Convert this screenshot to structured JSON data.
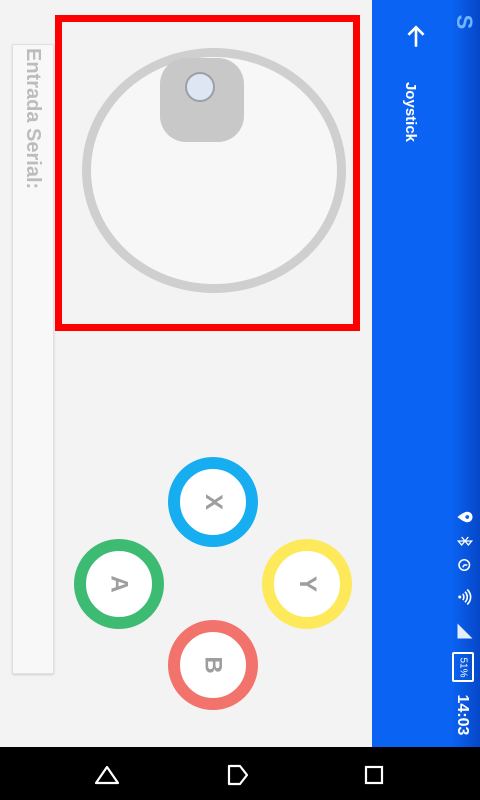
{
  "appbar": {
    "title": "Joystick",
    "back_icon": "arrow-back-icon",
    "brand_letter": "S"
  },
  "status_bar": {
    "battery": "51%",
    "time": "14:03",
    "icons": [
      "location-icon",
      "bluetooth-icon",
      "alarm-icon",
      "wifi-icon",
      "signal-icon"
    ]
  },
  "serial": {
    "label": "Entrada Serial:"
  },
  "buttons": {
    "x": "X",
    "a": "A",
    "y": "Y",
    "b": "B"
  },
  "colors": {
    "appbar": "#0a63f2",
    "highlight": "#ff0000",
    "x": "#16aef0",
    "a": "#3dbb72",
    "y": "#fde95a",
    "b": "#f2726c"
  },
  "navigation": {
    "back": "back-icon",
    "home": "home-icon",
    "recent": "recent-apps-icon"
  }
}
